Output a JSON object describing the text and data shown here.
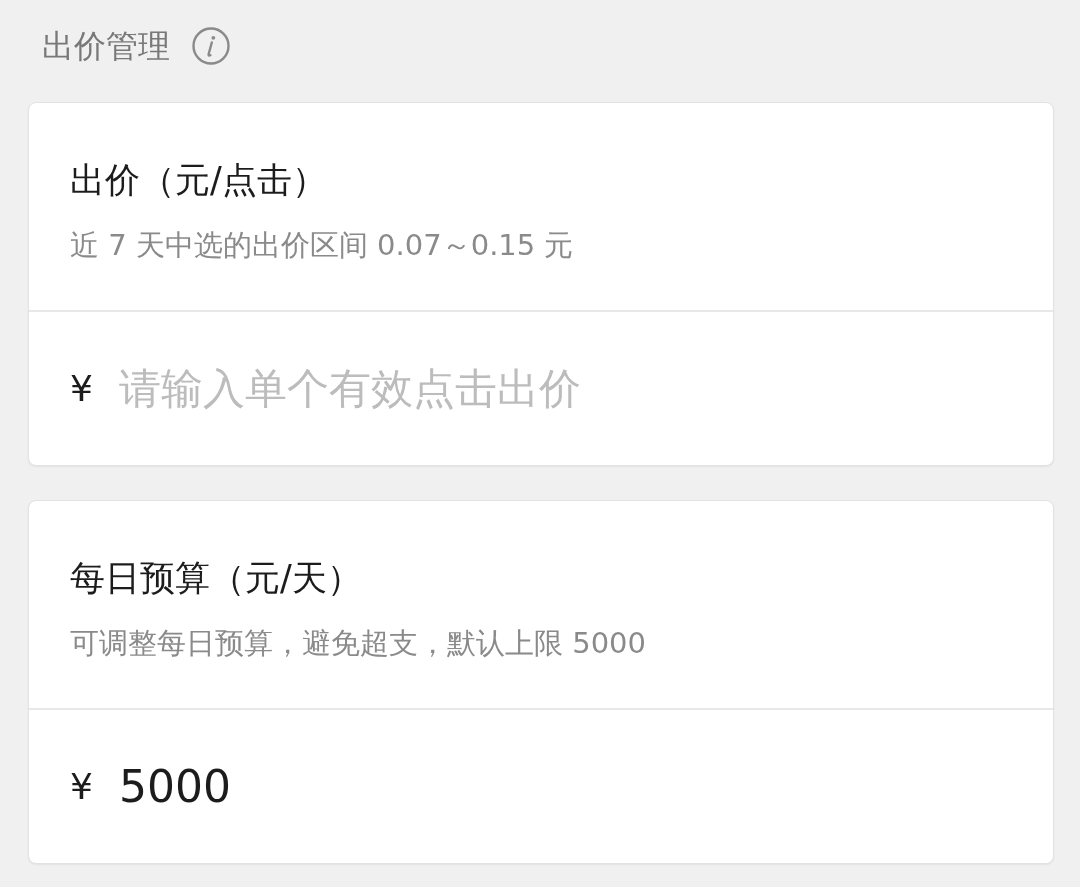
{
  "header": {
    "title": "出价管理"
  },
  "sections": [
    {
      "title": "出价（元/点击）",
      "hint": "近 7 天中选的出价区间 0.07～0.15 元",
      "field": {
        "prefix": "¥",
        "placeholder": "请输入单个有效点击出价"
      }
    },
    {
      "title": "每日预算（元/天）",
      "hint": "可调整每日预算，避免超支，默认上限 5000",
      "field": {
        "prefix": "¥",
        "value": "5000"
      }
    }
  ]
}
